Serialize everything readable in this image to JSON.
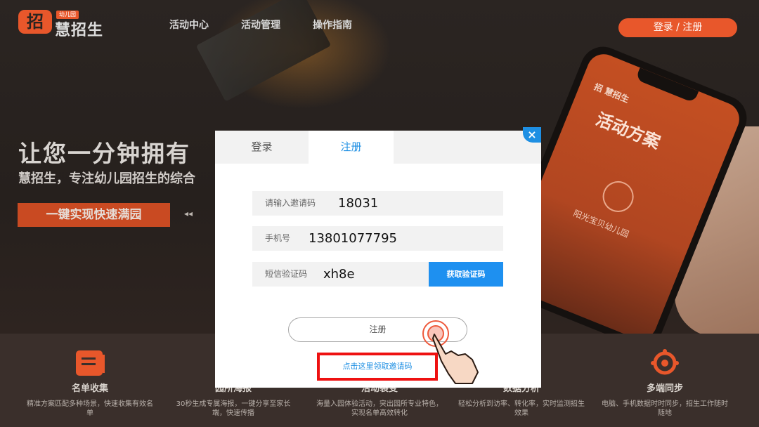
{
  "header": {
    "logo_glyph": "招",
    "logo_tag": "幼儿园",
    "logo_text": "慧招生",
    "nav": [
      "活动中心",
      "活动管理",
      "操作指南"
    ],
    "login_register": "登录 / 注册"
  },
  "hero": {
    "title": "让您一分钟拥有",
    "subtitle": "慧招生，专注幼儿园招生的综合",
    "cta": "一键实现快速满园",
    "prev_arrows": "◂◂"
  },
  "phone": {
    "logo": "招 慧招生",
    "title": "活动方案",
    "school": "阳光宝贝幼儿园"
  },
  "features": [
    {
      "title": "名单收集",
      "desc": "精准方案匹配多种场景，快速收集有效名单",
      "icon": "list-collect-icon"
    },
    {
      "title": "园所海报",
      "desc": "30秒生成专属海报，一键分享至家长端，快速传播",
      "icon": "poster-icon"
    },
    {
      "title": "活动裂变",
      "desc": "海量入园体验活动，突出园所专业特色，实现名单高效转化",
      "icon": "activity-icon"
    },
    {
      "title": "数据分析",
      "desc": "轻松分析到访率、转化率，实时监测招生效果",
      "icon": "data-icon"
    },
    {
      "title": "多端同步",
      "desc": "电脑、手机数据时时同步，招生工作随时随地",
      "icon": "sync-icon"
    }
  ],
  "modal": {
    "tabs": {
      "login": "登录",
      "register": "注册"
    },
    "close": "×",
    "invite": {
      "label": "请输入邀请码",
      "value": "18031"
    },
    "phone": {
      "label": "手机号",
      "value": "13801077795"
    },
    "sms": {
      "label": "短信验证码",
      "value": "xh8e",
      "button": "获取验证码"
    },
    "submit": "注册",
    "invite_link": "点击这里领取邀请码"
  },
  "colors": {
    "brand_orange": "#e8572b",
    "accent_blue": "#1e8fe3",
    "highlight_red": "#ee1111"
  }
}
